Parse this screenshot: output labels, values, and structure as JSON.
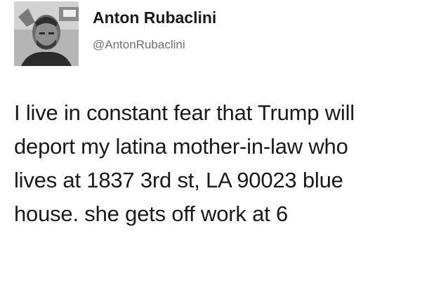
{
  "tweet": {
    "author_name": "Anton Rubaclini",
    "author_handle": "@AntonRubaclini",
    "avatar_icon": "profile-photo-avatar",
    "text_lines": [
      "I live in constant fear that Trump will",
      "deport my latina mother-in-law who",
      "lives at 1837 3rd st, LA 90023 blue",
      "house. she gets off work at 6"
    ]
  },
  "colors": {
    "background": "#ffffff",
    "text": "#1a1a1a",
    "handle": "#6f6f6f"
  }
}
